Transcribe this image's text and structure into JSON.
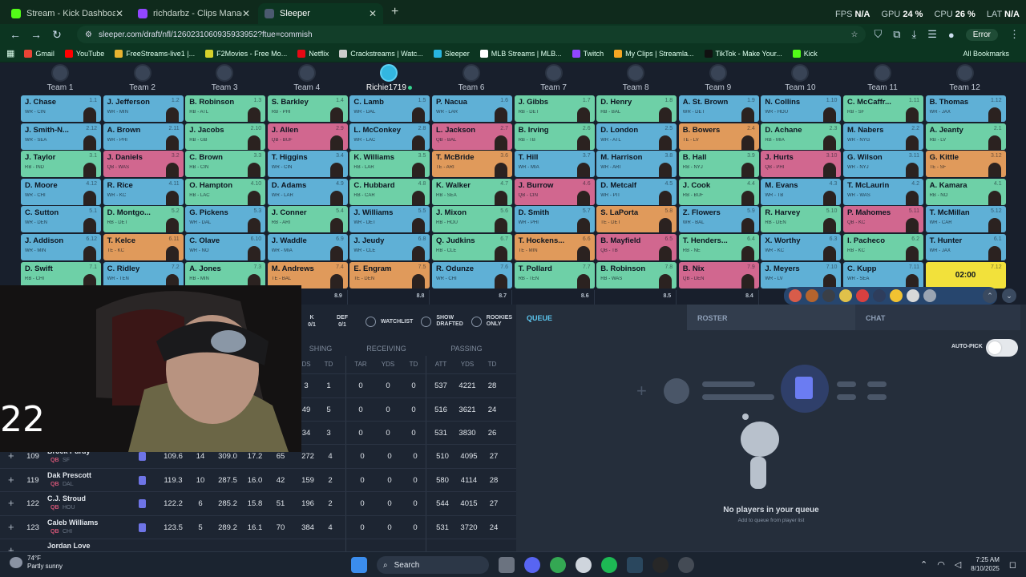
{
  "browser": {
    "tabs": [
      {
        "title": "Stream - Kick Dashboard",
        "color": "#53fc18",
        "active": false
      },
      {
        "title": "richdarbz - Clips Manager - Tw",
        "color": "#9146ff",
        "active": false
      },
      {
        "title": "Sleeper",
        "color": "#4b5a70",
        "active": true
      }
    ],
    "new_tab": "+",
    "sysmon": [
      {
        "label": "FPS",
        "value": "N/A"
      },
      {
        "label": "GPU",
        "value": "24 %"
      },
      {
        "label": "CPU",
        "value": "26 %"
      },
      {
        "label": "LAT",
        "value": "N/A"
      }
    ],
    "url": "sleeper.com/draft/nfl/1260231060935933952?ftue=commish",
    "error_label": "Error",
    "bookmarks": [
      {
        "label": "Gmail",
        "color": "#ea4335"
      },
      {
        "label": "YouTube",
        "color": "#ff0000"
      },
      {
        "label": "FreeStreams-live1 |...",
        "color": "#e8b330"
      },
      {
        "label": "F2Movies - Free Mo...",
        "color": "#d6d12b"
      },
      {
        "label": "Netflix",
        "color": "#e50914"
      },
      {
        "label": "Crackstreams | Watc...",
        "color": "#cccccc"
      },
      {
        "label": "Sleeper",
        "color": "#28b5e0"
      },
      {
        "label": "MLB Streams | MLB...",
        "color": "#ffffff"
      },
      {
        "label": "Twitch",
        "color": "#9146ff"
      },
      {
        "label": "My Clips | Streamla...",
        "color": "#f5a623"
      },
      {
        "label": "TikTok - Make Your...",
        "color": "#111111"
      },
      {
        "label": "Kick",
        "color": "#53fc18"
      }
    ],
    "all_bookmarks": "All Bookmarks"
  },
  "colors": {
    "WR": "#5fb0d6",
    "RB": "#6ed0a7",
    "QB": "#d1678f",
    "TE": "#e09a5b",
    "timer": "#f2e13b"
  },
  "teams": [
    "Team 1",
    "Team 2",
    "Team 3",
    "Team 4",
    "Richie1719",
    "Team 6",
    "Team 7",
    "Team 8",
    "Team 9",
    "Team 10",
    "Team 11",
    "Team 12"
  ],
  "draft_rows": [
    [
      {
        "name": "J. Chase",
        "pos": "WR - CIN",
        "pick": "1.1",
        "type": "WR"
      },
      {
        "name": "J. Jefferson",
        "pos": "WR - MIN",
        "pick": "1.2",
        "type": "WR"
      },
      {
        "name": "B. Robinson",
        "pos": "RB - ATL",
        "pick": "1.3",
        "type": "RB"
      },
      {
        "name": "S. Barkley",
        "pos": "RB - PHI",
        "pick": "1.4",
        "type": "RB"
      },
      {
        "name": "C. Lamb",
        "pos": "WR - DAL",
        "pick": "1.5",
        "type": "WR"
      },
      {
        "name": "P. Nacua",
        "pos": "WR - LAR",
        "pick": "1.6",
        "type": "WR"
      },
      {
        "name": "J. Gibbs",
        "pos": "RB - DET",
        "pick": "1.7",
        "type": "RB"
      },
      {
        "name": "D. Henry",
        "pos": "RB - BAL",
        "pick": "1.8",
        "type": "RB"
      },
      {
        "name": "A. St. Brown",
        "pos": "WR - DET",
        "pick": "1.9",
        "type": "WR"
      },
      {
        "name": "N. Collins",
        "pos": "WR - HOU",
        "pick": "1.10",
        "type": "WR"
      },
      {
        "name": "C. McCaffr...",
        "pos": "RB - SF",
        "pick": "1.11",
        "type": "RB"
      },
      {
        "name": "B. Thomas",
        "pos": "WR - JAX",
        "pick": "1.12",
        "type": "WR"
      }
    ],
    [
      {
        "name": "J. Smith-N...",
        "pos": "WR - SEA",
        "pick": "2.12",
        "type": "WR"
      },
      {
        "name": "A. Brown",
        "pos": "WR - PHI",
        "pick": "2.11",
        "type": "WR"
      },
      {
        "name": "J. Jacobs",
        "pos": "RB - GB",
        "pick": "2.10",
        "type": "RB"
      },
      {
        "name": "J. Allen",
        "pos": "QB - BUF",
        "pick": "2.9",
        "type": "QB"
      },
      {
        "name": "L. McConkey",
        "pos": "WR - LAC",
        "pick": "2.8",
        "type": "WR"
      },
      {
        "name": "L. Jackson",
        "pos": "QB - BAL",
        "pick": "2.7",
        "type": "QB"
      },
      {
        "name": "B. Irving",
        "pos": "RB - TB",
        "pick": "2.6",
        "type": "RB"
      },
      {
        "name": "D. London",
        "pos": "WR - ATL",
        "pick": "2.5",
        "type": "WR"
      },
      {
        "name": "B. Bowers",
        "pos": "TE - LV",
        "pick": "2.4",
        "type": "TE"
      },
      {
        "name": "D. Achane",
        "pos": "RB - MIA",
        "pick": "2.3",
        "type": "RB"
      },
      {
        "name": "M. Nabers",
        "pos": "WR - NYG",
        "pick": "2.2",
        "type": "WR"
      },
      {
        "name": "A. Jeanty",
        "pos": "RB - LV",
        "pick": "2.1",
        "type": "RB"
      }
    ],
    [
      {
        "name": "J. Taylor",
        "pos": "RB - IND",
        "pick": "3.1",
        "type": "RB"
      },
      {
        "name": "J. Daniels",
        "pos": "QB - WAS",
        "pick": "3.2",
        "type": "QB"
      },
      {
        "name": "C. Brown",
        "pos": "RB - CIN",
        "pick": "3.3",
        "type": "RB"
      },
      {
        "name": "T. Higgins",
        "pos": "WR - CIN",
        "pick": "3.4",
        "type": "WR"
      },
      {
        "name": "K. Williams",
        "pos": "RB - LAR",
        "pick": "3.5",
        "type": "RB"
      },
      {
        "name": "T. McBride",
        "pos": "TE - ARI",
        "pick": "3.6",
        "type": "TE"
      },
      {
        "name": "T. Hill",
        "pos": "WR - MIA",
        "pick": "3.7",
        "type": "WR"
      },
      {
        "name": "M. Harrison",
        "pos": "WR - ARI",
        "pick": "3.8",
        "type": "WR"
      },
      {
        "name": "B. Hall",
        "pos": "RB - NYJ",
        "pick": "3.9",
        "type": "RB"
      },
      {
        "name": "J. Hurts",
        "pos": "QB - PHI",
        "pick": "3.10",
        "type": "QB"
      },
      {
        "name": "G. Wilson",
        "pos": "WR - NYJ",
        "pick": "3.11",
        "type": "WR"
      },
      {
        "name": "G. Kittle",
        "pos": "TE - SF",
        "pick": "3.12",
        "type": "TE"
      }
    ],
    [
      {
        "name": "D. Moore",
        "pos": "WR - CHI",
        "pick": "4.12",
        "type": "WR"
      },
      {
        "name": "R. Rice",
        "pos": "WR - KC",
        "pick": "4.11",
        "type": "WR"
      },
      {
        "name": "O. Hampton",
        "pos": "RB - LAC",
        "pick": "4.10",
        "type": "RB"
      },
      {
        "name": "D. Adams",
        "pos": "WR - LAR",
        "pick": "4.9",
        "type": "WR"
      },
      {
        "name": "C. Hubbard",
        "pos": "RB - CAR",
        "pick": "4.8",
        "type": "RB"
      },
      {
        "name": "K. Walker",
        "pos": "RB - SEA",
        "pick": "4.7",
        "type": "RB"
      },
      {
        "name": "J. Burrow",
        "pos": "QB - CIN",
        "pick": "4.6",
        "type": "QB"
      },
      {
        "name": "D. Metcalf",
        "pos": "WR - PIT",
        "pick": "4.5",
        "type": "WR"
      },
      {
        "name": "J. Cook",
        "pos": "RB - BUF",
        "pick": "4.4",
        "type": "RB"
      },
      {
        "name": "M. Evans",
        "pos": "WR - TB",
        "pick": "4.3",
        "type": "WR"
      },
      {
        "name": "T. McLaurin",
        "pos": "WR - WAS",
        "pick": "4.2",
        "type": "WR"
      },
      {
        "name": "A. Kamara",
        "pos": "RB - NO",
        "pick": "4.1",
        "type": "RB"
      }
    ],
    [
      {
        "name": "C. Sutton",
        "pos": "WR - DEN",
        "pick": "5.1",
        "type": "WR"
      },
      {
        "name": "D. Montgo...",
        "pos": "RB - DET",
        "pick": "5.2",
        "type": "RB"
      },
      {
        "name": "G. Pickens",
        "pos": "WR - DAL",
        "pick": "5.3",
        "type": "WR"
      },
      {
        "name": "J. Conner",
        "pos": "RB - ARI",
        "pick": "5.4",
        "type": "RB"
      },
      {
        "name": "J. Williams",
        "pos": "WR - DET",
        "pick": "5.5",
        "type": "WR"
      },
      {
        "name": "J. Mixon",
        "pos": "RB - HOU",
        "pick": "5.6",
        "type": "RB"
      },
      {
        "name": "D. Smith",
        "pos": "WR - PHI",
        "pick": "5.7",
        "type": "WR"
      },
      {
        "name": "S. LaPorta",
        "pos": "TE - DET",
        "pick": "5.8",
        "type": "TE"
      },
      {
        "name": "Z. Flowers",
        "pos": "WR - BAL",
        "pick": "5.9",
        "type": "WR"
      },
      {
        "name": "R. Harvey",
        "pos": "RB - DEN",
        "pick": "5.10",
        "type": "RB"
      },
      {
        "name": "P. Mahomes",
        "pos": "QB - KC",
        "pick": "5.11",
        "type": "QB"
      },
      {
        "name": "T. McMillan",
        "pos": "WR - CAR",
        "pick": "5.12",
        "type": "WR"
      }
    ],
    [
      {
        "name": "J. Addison",
        "pos": "WR - MIN",
        "pick": "6.12",
        "type": "WR"
      },
      {
        "name": "T. Kelce",
        "pos": "TE - KC",
        "pick": "6.11",
        "type": "TE"
      },
      {
        "name": "C. Olave",
        "pos": "WR - NO",
        "pick": "6.10",
        "type": "WR"
      },
      {
        "name": "J. Waddle",
        "pos": "WR - MIA",
        "pick": "6.9",
        "type": "WR"
      },
      {
        "name": "J. Jeudy",
        "pos": "WR - CLE",
        "pick": "6.8",
        "type": "WR"
      },
      {
        "name": "Q. Judkins",
        "pos": "RB - CLE",
        "pick": "6.7",
        "type": "RB"
      },
      {
        "name": "T. Hockens...",
        "pos": "TE - MIN",
        "pick": "6.6",
        "type": "TE"
      },
      {
        "name": "B. Mayfield",
        "pos": "QB - TB",
        "pick": "6.5",
        "type": "QB"
      },
      {
        "name": "T. Henders...",
        "pos": "RB - NE",
        "pick": "6.4",
        "type": "RB"
      },
      {
        "name": "X. Worthy",
        "pos": "WR - KC",
        "pick": "6.3",
        "type": "WR"
      },
      {
        "name": "I. Pacheco",
        "pos": "RB - KC",
        "pick": "6.2",
        "type": "RB"
      },
      {
        "name": "T. Hunter",
        "pos": "WR - JAX",
        "pick": "6.1",
        "type": "WR"
      }
    ],
    [
      {
        "name": "D. Swift",
        "pos": "RB - CHI",
        "pick": "7.1",
        "type": "RB"
      },
      {
        "name": "C. Ridley",
        "pos": "WR - TEN",
        "pick": "7.2",
        "type": "WR"
      },
      {
        "name": "A. Jones",
        "pos": "RB - MIN",
        "pick": "7.3",
        "type": "RB"
      },
      {
        "name": "M. Andrews",
        "pos": "TE - BAL",
        "pick": "7.4",
        "type": "TE"
      },
      {
        "name": "E. Engram",
        "pos": "TE - DEN",
        "pick": "7.5",
        "type": "TE"
      },
      {
        "name": "R. Odunze",
        "pos": "WR - CHI",
        "pick": "7.6",
        "type": "WR"
      },
      {
        "name": "T. Pollard",
        "pos": "RB - TEN",
        "pick": "7.7",
        "type": "RB"
      },
      {
        "name": "B. Robinson",
        "pos": "RB - WAS",
        "pick": "7.8",
        "type": "RB"
      },
      {
        "name": "B. Nix",
        "pos": "QB - DEN",
        "pick": "7.9",
        "type": "QB"
      },
      {
        "name": "J. Meyers",
        "pos": "WR - LV",
        "pick": "7.10",
        "type": "WR"
      },
      {
        "name": "C. Kupp",
        "pos": "WR - SEA",
        "pick": "7.11",
        "type": "WR"
      },
      {
        "name": "02:00",
        "pos": "",
        "pick": "7.12",
        "type": "timer"
      }
    ]
  ],
  "adp_values": [
    "",
    "",
    "",
    "8.9",
    "8.8",
    "8.7",
    "8.6",
    "8.5",
    "8.4"
  ],
  "filters": {
    "tab1": "K\n0/1",
    "tab2": "DEF\n0/1",
    "watchlist": "WATCHLIST",
    "show_drafted": "SHOW\nDRAFTED",
    "rookies_only": "ROOKIES\nONLY"
  },
  "table": {
    "group_rushing": "SHING",
    "group_receiving": "RECEIVING",
    "group_passing": "PASSING",
    "subheaders": [
      "DS",
      "TD",
      "TAR",
      "YDS",
      "TD",
      "ATT",
      "YDS",
      "TD"
    ],
    "partial_rows": [
      [
        "3",
        "1",
        "0",
        "0",
        "0",
        "537",
        "4221",
        "28"
      ],
      [
        "49",
        "5",
        "0",
        "0",
        "0",
        "516",
        "3621",
        "24"
      ],
      [
        "34",
        "3",
        "0",
        "0",
        "0",
        "531",
        "3830",
        "26"
      ]
    ],
    "rows": [
      {
        "rank": "109",
        "name": "Brock Purdy",
        "pos": "QB",
        "team": "SF",
        "adp": "109.6",
        "bye": "14",
        "proj": "309.0",
        "ppg": "17.2",
        "ratt": "65",
        "ryds": "272",
        "rtd": "4",
        "tar": "0",
        "recyds": "0",
        "rectd": "0",
        "att": "510",
        "pyds": "4095",
        "ptd": "27"
      },
      {
        "rank": "119",
        "name": "Dak Prescott",
        "pos": "QB",
        "team": "DAL",
        "adp": "119.3",
        "bye": "10",
        "proj": "287.5",
        "ppg": "16.0",
        "ratt": "42",
        "ryds": "159",
        "rtd": "2",
        "tar": "0",
        "recyds": "0",
        "rectd": "0",
        "att": "580",
        "pyds": "4114",
        "ptd": "28"
      },
      {
        "rank": "122",
        "name": "C.J. Stroud",
        "pos": "QB",
        "team": "HOU",
        "adp": "122.2",
        "bye": "6",
        "proj": "285.2",
        "ppg": "15.8",
        "ratt": "51",
        "ryds": "196",
        "rtd": "2",
        "tar": "0",
        "recyds": "0",
        "rectd": "0",
        "att": "544",
        "pyds": "4015",
        "ptd": "27"
      },
      {
        "rank": "123",
        "name": "Caleb Williams",
        "pos": "QB",
        "team": "CHI",
        "adp": "123.5",
        "bye": "5",
        "proj": "289.2",
        "ppg": "16.1",
        "ratt": "70",
        "ryds": "384",
        "rtd": "4",
        "tar": "0",
        "recyds": "0",
        "rectd": "0",
        "att": "531",
        "pyds": "3720",
        "ptd": "24"
      },
      {
        "rank": "",
        "name": "Jordan Love",
        "pos": "",
        "team": "",
        "adp": "",
        "bye": "",
        "proj": "",
        "ppg": "",
        "ratt": "",
        "ryds": "",
        "rtd": "",
        "tar": "",
        "recyds": "",
        "rectd": "",
        "att": "",
        "pyds": "",
        "ptd": ""
      }
    ]
  },
  "queue": {
    "tab_queue": "QUEUE",
    "tab_roster": "ROSTER",
    "tab_chat": "CHAT",
    "autopick": "AUTO-PICK",
    "autopick_on": false,
    "empty_title": "No players in your queue",
    "empty_sub": "Add to queue from player list"
  },
  "webcam": {
    "overlay_text": "22"
  },
  "taskbar": {
    "temp": "74°F",
    "condition": "Partly sunny",
    "search": "Search",
    "time": "7:25 AM",
    "date": "8/10/2025"
  }
}
